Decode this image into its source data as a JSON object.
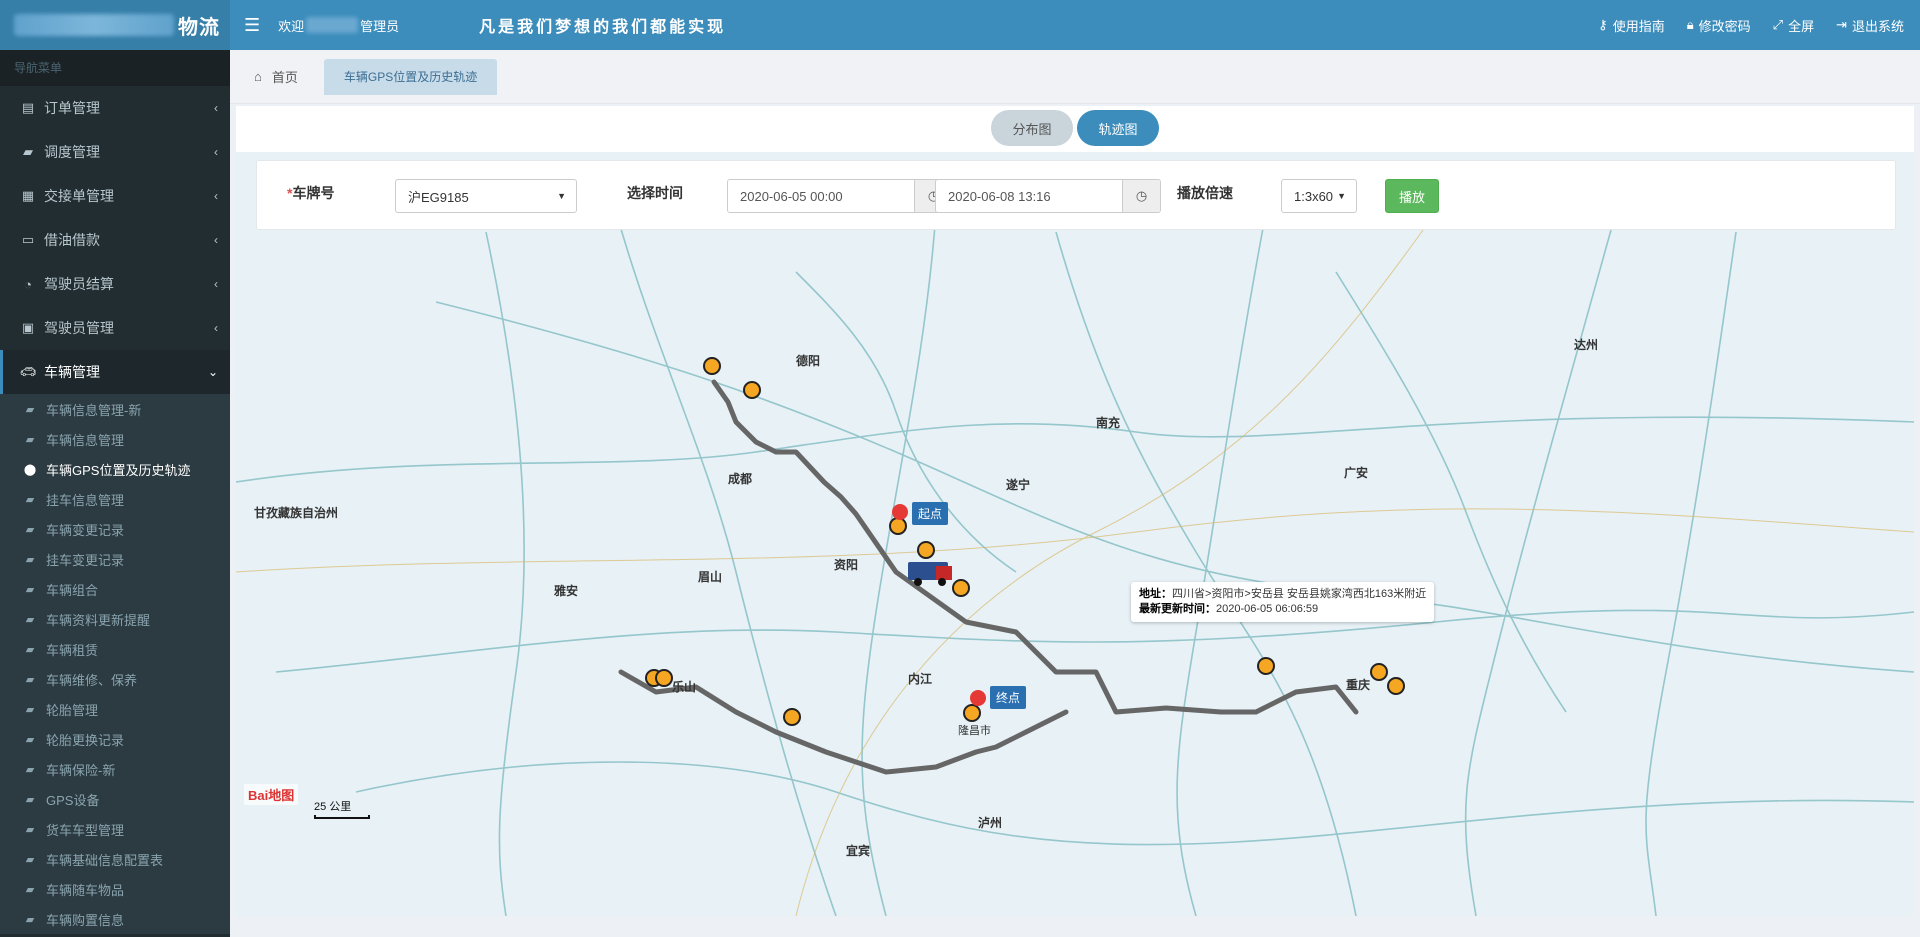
{
  "topbar": {
    "brand_suffix": "物流",
    "welcome_prefix": "欢迎",
    "welcome_suffix": "管理员",
    "slogan": "凡是我们梦想的我们都能实现",
    "actions": [
      "使用指南",
      "修改密码",
      "全屏",
      "退出系统"
    ]
  },
  "sidebar": {
    "header": "导航菜单",
    "items": [
      {
        "label": "订单管理",
        "icon": "book-icon"
      },
      {
        "label": "调度管理",
        "icon": "truck-icon"
      },
      {
        "label": "交接单管理",
        "icon": "form-icon"
      },
      {
        "label": "借油借款",
        "icon": "card-icon"
      },
      {
        "label": "驾驶员结算",
        "icon": "dashboard-icon"
      },
      {
        "label": "驾驶员管理",
        "icon": "id-icon"
      },
      {
        "label": "车辆管理",
        "icon": "car-icon"
      }
    ],
    "subitems": [
      "车辆信息管理-新",
      "车辆信息管理",
      "车辆GPS位置及历史轨迹",
      "挂车信息管理",
      "车辆变更记录",
      "挂车变更记录",
      "车辆组合",
      "车辆资料更新提醒",
      "车辆租赁",
      "车辆维修、保养",
      "轮胎管理",
      "轮胎更换记录",
      "车辆保险-新",
      "GPS设备",
      "货车车型管理",
      "车辆基础信息配置表",
      "车辆随车物品",
      "车辆购置信息"
    ],
    "current_subitem_index": 2
  },
  "tabs": {
    "home": "首页",
    "current": "车辆GPS位置及历史轨迹"
  },
  "view_switch": {
    "off": "分布图",
    "on": "轨迹图"
  },
  "filters": {
    "plate_label": "车牌号",
    "required_mark": "*",
    "plate_value": "沪EG9185",
    "time_label": "选择时间",
    "start_time": "2020-06-05 00:00",
    "end_time": "2020-06-08 13:16",
    "speed_label": "播放倍速",
    "speed_value": "1:3x60",
    "play_button": "播放"
  },
  "map": {
    "start_label": "起点",
    "end_label": "终点",
    "tooltip": {
      "address_label": "地址：",
      "address": "四川省>资阳市>安岳县 安岳县姚家湾西北163米附近",
      "update_label": "最新更新时间：",
      "update_time": "2020-06-05 06:06:59"
    },
    "scale": "25 公里",
    "logo": "Bai地图",
    "places": [
      "甘孜藏族自治州",
      "成都",
      "德阳",
      "资阳",
      "眉山",
      "雅安",
      "乐山",
      "内江",
      "遂宁",
      "南充",
      "重庆",
      "达州",
      "泸州",
      "宜宾",
      "隆昌市",
      "广安"
    ]
  }
}
